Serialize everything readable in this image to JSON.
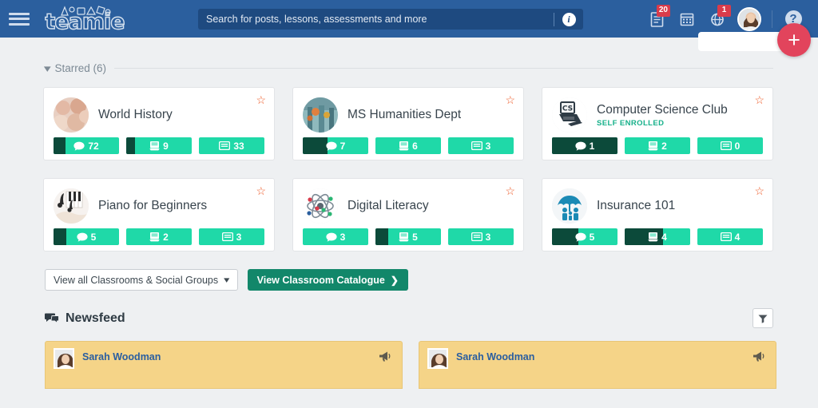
{
  "header": {
    "menu_icon": "hamburger-icon",
    "logo_text": "teamie",
    "search": {
      "placeholder": "Search for posts, lessons, assessments and more",
      "value": "",
      "info_icon": "info-icon"
    },
    "icons": [
      {
        "name": "documents-icon",
        "badge": "20"
      },
      {
        "name": "calendar-icon",
        "badge": ""
      },
      {
        "name": "notifications-globe-icon",
        "badge": "1"
      }
    ],
    "avatar": "user-avatar",
    "help_label": "?",
    "fab_label": "+"
  },
  "starred": {
    "label": "Starred (6)",
    "chevron": "chevron-down-icon"
  },
  "cards": [
    {
      "title": "World History",
      "subtitle": "",
      "avatar_kind": "photo-pink",
      "starred": true,
      "badges": [
        {
          "icon": "comment-icon",
          "count": "72",
          "fill_pct": 18
        },
        {
          "icon": "lesson-book-icon",
          "count": "9",
          "fill_pct": 14
        },
        {
          "icon": "assessment-card-icon",
          "count": "33",
          "fill_pct": 0
        }
      ]
    },
    {
      "title": "MS Humanities Dept",
      "subtitle": "",
      "avatar_kind": "photo-teal",
      "starred": true,
      "badges": [
        {
          "icon": "comment-icon",
          "count": "7",
          "fill_pct": 38
        },
        {
          "icon": "lesson-book-icon",
          "count": "6",
          "fill_pct": 0
        },
        {
          "icon": "assessment-card-icon",
          "count": "3",
          "fill_pct": 0
        }
      ]
    },
    {
      "title": "Computer Science Club",
      "subtitle": "SELF ENROLLED",
      "avatar_kind": "cs-logo",
      "starred": true,
      "badges": [
        {
          "icon": "comment-icon",
          "count": "1",
          "fill_pct": 100
        },
        {
          "icon": "lesson-book-icon",
          "count": "2",
          "fill_pct": 0
        },
        {
          "icon": "assessment-card-icon",
          "count": "0",
          "fill_pct": 0
        }
      ]
    },
    {
      "title": "Piano for Beginners",
      "subtitle": "",
      "avatar_kind": "piano",
      "starred": true,
      "badges": [
        {
          "icon": "comment-icon",
          "count": "5",
          "fill_pct": 19
        },
        {
          "icon": "lesson-book-icon",
          "count": "2",
          "fill_pct": 0
        },
        {
          "icon": "assessment-card-icon",
          "count": "3",
          "fill_pct": 0
        }
      ]
    },
    {
      "title": "Digital Literacy",
      "subtitle": "",
      "avatar_kind": "atom",
      "starred": true,
      "badges": [
        {
          "icon": "comment-icon",
          "count": "3",
          "fill_pct": 0
        },
        {
          "icon": "lesson-book-icon",
          "count": "5",
          "fill_pct": 20
        },
        {
          "icon": "assessment-card-icon",
          "count": "3",
          "fill_pct": 0
        }
      ]
    },
    {
      "title": "Insurance 101",
      "subtitle": "",
      "avatar_kind": "umbrella",
      "starred": true,
      "badges": [
        {
          "icon": "comment-icon",
          "count": "5",
          "fill_pct": 40
        },
        {
          "icon": "lesson-book-icon",
          "count": "4",
          "fill_pct": 59
        },
        {
          "icon": "assessment-card-icon",
          "count": "4",
          "fill_pct": 0
        }
      ]
    }
  ],
  "controls": {
    "select_label": "View all Classrooms & Social Groups",
    "select_caret": "chevron-down-icon",
    "catalogue_button": "View Classroom Catalogue",
    "catalogue_caret": "❯"
  },
  "newsfeed": {
    "title": "Newsfeed",
    "title_icon": "comments-icon",
    "filter_icon": "filter-funnel-icon",
    "posts": [
      {
        "author": "Sarah Woodman",
        "icon": "megaphone-icon"
      },
      {
        "author": "Sarah Woodman",
        "icon": "megaphone-icon"
      }
    ]
  },
  "colors": {
    "header_blue": "#2b5f9e",
    "search_blue": "#1e4a80",
    "teal": "#1fd9a8",
    "teal_dark": "#0c4a3a",
    "green_button": "#12876a",
    "star_orange": "#ee5b28",
    "badge_red": "#d93b4b",
    "fab_red": "#e2445c",
    "post_amber": "#f5d488",
    "page_bg": "#eef0f2"
  }
}
